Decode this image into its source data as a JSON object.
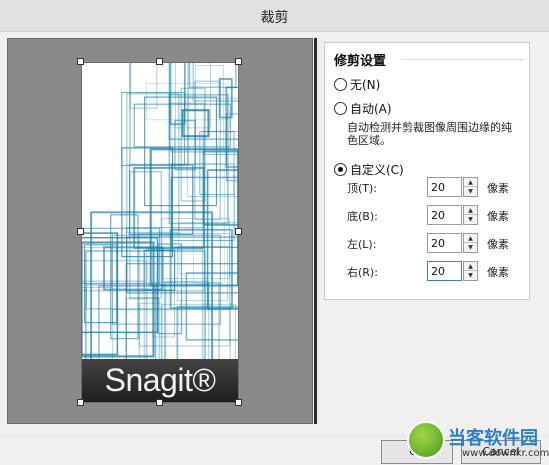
{
  "window": {
    "title": "裁剪"
  },
  "preview": {
    "brand_text": "Snagit®"
  },
  "panel": {
    "heading": "修剪设置",
    "options": [
      {
        "label": "无(N)",
        "selected": false
      },
      {
        "label": "自动(A)",
        "selected": false
      },
      {
        "label": "自定义(C)",
        "selected": true
      }
    ],
    "auto_description": "自动检测并剪裁图像周围边缘的纯色区域。",
    "fields": [
      {
        "label": "顶(T):",
        "value": "20",
        "unit": "像素"
      },
      {
        "label": "底(B):",
        "value": "20",
        "unit": "像素"
      },
      {
        "label": "左(L):",
        "value": "20",
        "unit": "像素"
      },
      {
        "label": "右(R):",
        "value": "20",
        "unit": "像素"
      }
    ]
  },
  "buttons": {
    "ok_label": "OK",
    "cancel_label": "Cancel"
  },
  "watermark": {
    "site_name": "当客软件园",
    "url": "www.downkr.com"
  },
  "colors": {
    "line_teal": "#1a7fa8",
    "preview_bg": "#8a8a8a",
    "brand_bar": "#1d1d1d"
  }
}
